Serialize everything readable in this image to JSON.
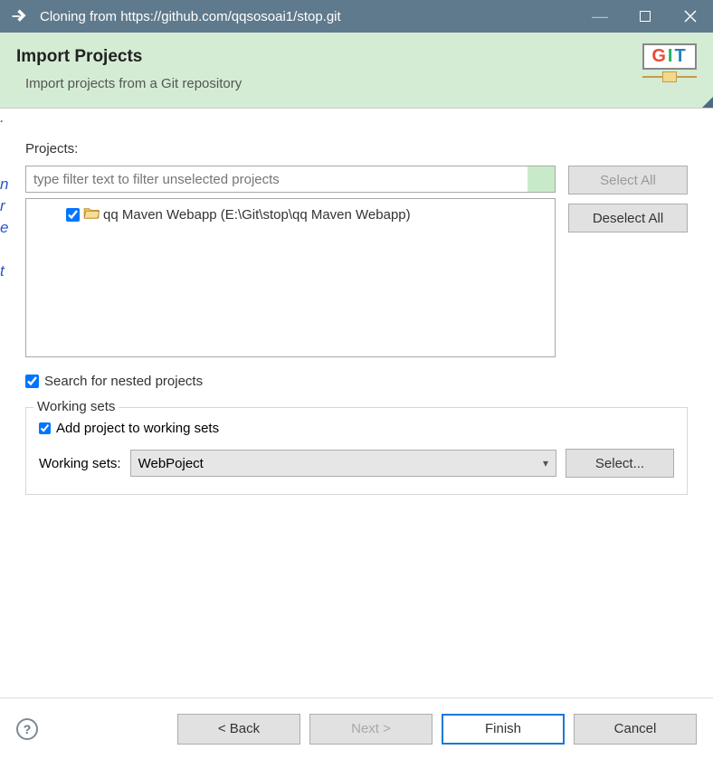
{
  "window": {
    "title": "Cloning from https://github.com/qqsosoai1/stop.git"
  },
  "banner": {
    "heading": "Import Projects",
    "subheading": "Import projects from a Git repository",
    "badge": "GIT"
  },
  "projects": {
    "label": "Projects:",
    "filter_placeholder": "type filter text to filter unselected projects",
    "items": [
      {
        "checked": true,
        "label": "qq Maven Webapp (E:\\Git\\stop\\qq Maven Webapp)"
      }
    ],
    "select_all": "Select All",
    "deselect_all": "Deselect All",
    "search_nested_checked": true,
    "search_nested_label": "Search for nested projects"
  },
  "working_sets": {
    "legend": "Working sets",
    "add_checked": true,
    "add_label": "Add project to working sets",
    "label": "Working sets:",
    "selected": "WebPoject",
    "select_button": "Select..."
  },
  "footer": {
    "back": "< Back",
    "next": "Next >",
    "finish": "Finish",
    "cancel": "Cancel"
  }
}
